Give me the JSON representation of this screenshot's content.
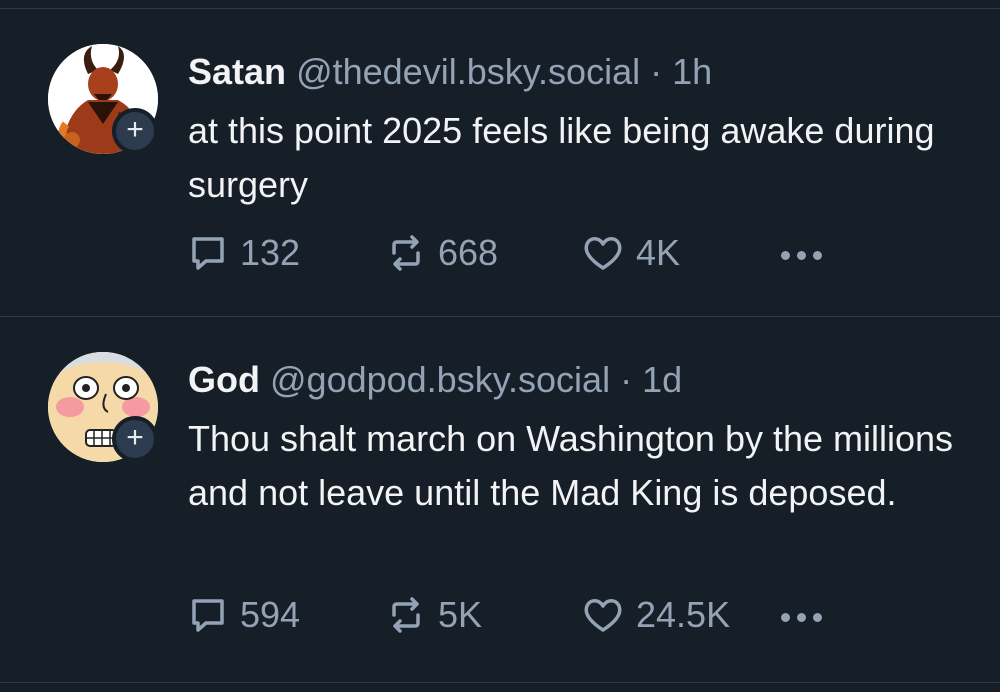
{
  "posts": [
    {
      "display_name": "Satan",
      "handle": "@thedevil.bsky.social",
      "separator": "·",
      "time": "1h",
      "text": "at this point 2025 feels like being awake during surgery",
      "replies": "132",
      "reposts": "668",
      "likes": "4K",
      "avatar_icon": "devil-avatar-icon",
      "follow_label": "+"
    },
    {
      "display_name": "God",
      "handle": "@godpod.bsky.social",
      "separator": "·",
      "time": "1d",
      "text": "Thou shalt march on Washington by the millions and not leave until the Mad King is deposed.",
      "replies": "594",
      "reposts": "5K",
      "likes": "24.5K",
      "avatar_icon": "god-cartoon-avatar-icon",
      "follow_label": "+"
    }
  ],
  "colors": {
    "background": "#161e27",
    "text": "#f1f3f5",
    "muted": "#93a3b5",
    "divider": "#2e3a48"
  }
}
